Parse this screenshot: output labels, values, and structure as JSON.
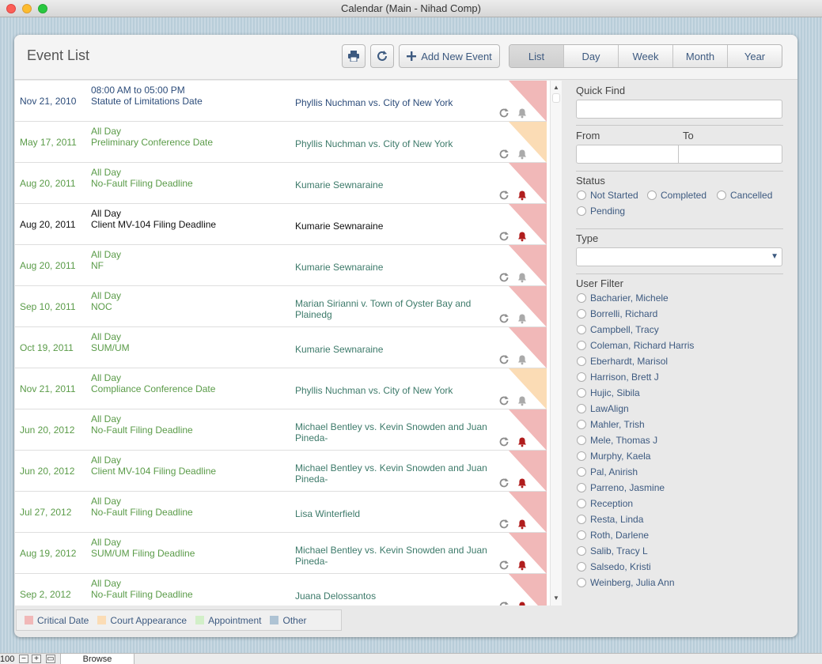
{
  "window": {
    "title": "Calendar (Main - Nihad Comp)"
  },
  "header": {
    "title": "Event List",
    "print_icon": "printer-icon",
    "refresh_icon": "refresh-icon",
    "add_event_label": "Add New Event",
    "view_tabs": [
      {
        "label": "List",
        "active": true
      },
      {
        "label": "Day",
        "active": false
      },
      {
        "label": "Week",
        "active": false
      },
      {
        "label": "Month",
        "active": false
      },
      {
        "label": "Year",
        "active": false
      }
    ]
  },
  "colors": {
    "critical": "#f1b8b8",
    "court": "#fbdcb5",
    "appointment": "#d2efc8",
    "other": "#aec3d4",
    "bell_active": "#b01d1d",
    "bell_inactive": "#aaaaaa"
  },
  "events": [
    {
      "date": "Nov 21, 2010",
      "time": "08:00 AM  to  05:00 PM",
      "name": "Statute of Limitations Date",
      "client": "Phyllis Nuchman vs. City of New York",
      "flag": "critical",
      "alarm": false,
      "style": "normal"
    },
    {
      "date": "May 17, 2011",
      "time": "All Day",
      "name": "Preliminary Conference Date",
      "client": "Phyllis Nuchman vs. City of New York",
      "flag": "court",
      "alarm": false,
      "style": "green"
    },
    {
      "date": "Aug 20, 2011",
      "time": "All Day",
      "name": "No-Fault Filing Deadline",
      "client": "Kumarie Sewnaraine",
      "flag": "critical",
      "alarm": true,
      "style": "green"
    },
    {
      "date": "Aug 20, 2011",
      "time": "All Day",
      "name": "Client MV-104 Filing Deadline",
      "client": "Kumarie Sewnaraine",
      "flag": "critical",
      "alarm": true,
      "style": "black"
    },
    {
      "date": "Aug 20, 2011",
      "time": "All Day",
      "name": "NF",
      "client": "Kumarie Sewnaraine",
      "flag": "critical",
      "alarm": false,
      "style": "green"
    },
    {
      "date": "Sep 10, 2011",
      "time": "All Day",
      "name": "NOC",
      "client": "Marian Sirianni v. Town of Oyster Bay and Plainedg",
      "flag": "critical",
      "alarm": false,
      "style": "green"
    },
    {
      "date": "Oct 19, 2011",
      "time": "All Day",
      "name": "SUM/UM",
      "client": "Kumarie Sewnaraine",
      "flag": "critical",
      "alarm": false,
      "style": "green"
    },
    {
      "date": "Nov 21, 2011",
      "time": "All Day",
      "name": "Compliance Conference Date",
      "client": "Phyllis Nuchman vs. City of New York",
      "flag": "court",
      "alarm": false,
      "style": "green"
    },
    {
      "date": "Jun 20, 2012",
      "time": "All Day",
      "name": "No-Fault Filing Deadline",
      "client": "Michael Bentley vs. Kevin Snowden and Juan Pineda-",
      "flag": "critical",
      "alarm": true,
      "style": "green"
    },
    {
      "date": "Jun 20, 2012",
      "time": "All Day",
      "name": "Client MV-104 Filing Deadline",
      "client": "Michael Bentley vs. Kevin Snowden and Juan Pineda-",
      "flag": "critical",
      "alarm": true,
      "style": "green"
    },
    {
      "date": "Jul 27, 2012",
      "time": "All Day",
      "name": "No-Fault Filing Deadline",
      "client": "Lisa Winterfield",
      "flag": "critical",
      "alarm": true,
      "style": "green"
    },
    {
      "date": "Aug 19, 2012",
      "time": "All Day",
      "name": "SUM/UM Filing Deadline",
      "client": "Michael Bentley vs. Kevin Snowden and Juan Pineda-",
      "flag": "critical",
      "alarm": true,
      "style": "green"
    },
    {
      "date": "Sep 2, 2012",
      "time": "All Day",
      "name": "No-Fault Filing Deadline",
      "client": "Juana Delossantos",
      "flag": "critical",
      "alarm": true,
      "style": "green"
    }
  ],
  "legend": [
    {
      "label": "Critical Date",
      "color_key": "critical"
    },
    {
      "label": "Court Appearance",
      "color_key": "court"
    },
    {
      "label": "Appointment",
      "color_key": "appointment"
    },
    {
      "label": "Other",
      "color_key": "other"
    }
  ],
  "sidebar": {
    "quick_find_label": "Quick Find",
    "quick_find_value": "",
    "from_label": "From",
    "to_label": "To",
    "from_value": "",
    "to_value": "",
    "status_label": "Status",
    "status_options": [
      "Not Started",
      "Completed",
      "Cancelled",
      "Pending"
    ],
    "type_label": "Type",
    "type_value": "",
    "user_filter_label": "User Filter",
    "users": [
      "Bacharier, Michele",
      "Borrelli, Richard",
      "Campbell, Tracy",
      "Coleman, Richard Harris",
      "Eberhardt, Marisol",
      "Harrison, Brett J",
      "Hujic, Sibila",
      "LawAlign",
      "Mahler, Trish",
      "Mele, Thomas J",
      "Murphy, Kaela",
      "Pal, Anirish",
      "Parreno, Jasmine",
      "Reception",
      "Resta, Linda",
      "Roth, Darlene",
      "Salib, Tracy L",
      "Salsedo, Kristi",
      "Weinberg, Julia Ann"
    ]
  },
  "statusbar": {
    "zoom": "100",
    "mode": "Browse"
  }
}
